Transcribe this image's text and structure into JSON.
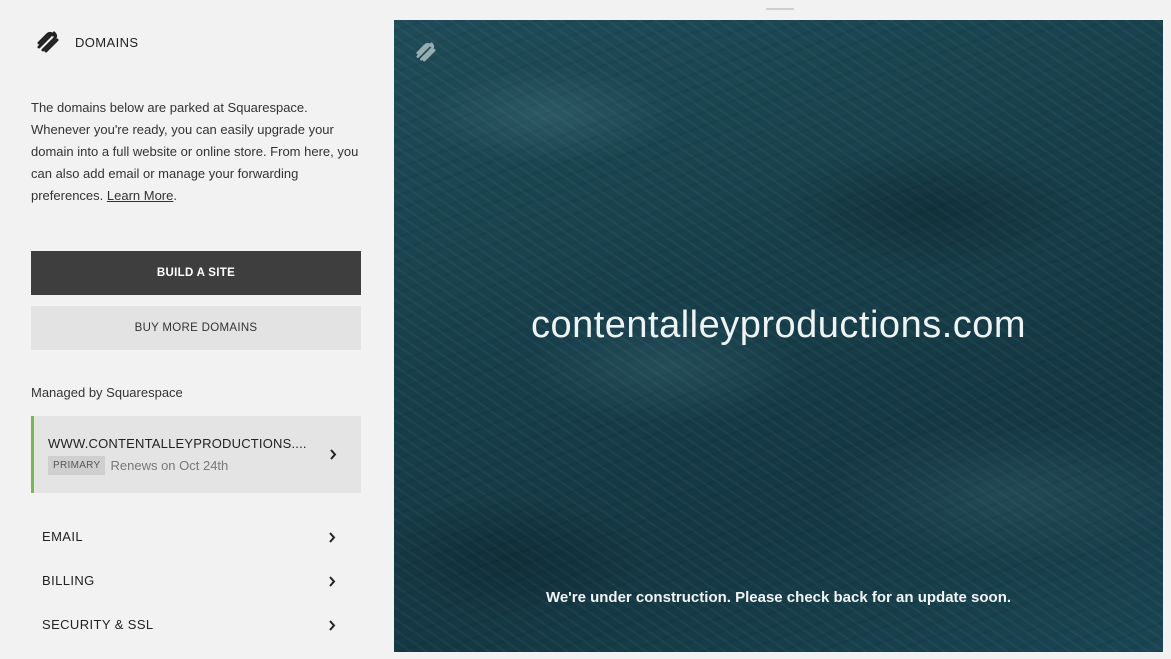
{
  "sidebar": {
    "brand_title": "DOMAINS",
    "intro_text": "The domains below are parked at Squarespace. Whenever you're ready, you can easily upgrade your domain into a full website or online store. From here, you can also add email or manage your forwarding preferences.",
    "learn_more": "Learn More",
    "build_site_label": "BUILD A SITE",
    "buy_domains_label": "BUY MORE DOMAINS",
    "managed_label": "Managed by Squarespace",
    "domain": {
      "name": "WWW.CONTENTALLEYPRODUCTIONS....",
      "badge": "PRIMARY",
      "renewal": "Renews on Oct 24th"
    },
    "nav": {
      "email": "EMAIL",
      "billing": "BILLING",
      "security": "SECURITY & SSL"
    }
  },
  "preview": {
    "domain": "contentalleyproductions.com",
    "message": "We're under construction. Please check back for an update soon."
  },
  "colors": {
    "primary_button": "#3e3e3e",
    "accent_border": "#76b852",
    "preview_bg": "#173f4b"
  },
  "icons": [
    "squarespace-logo-icon",
    "chevron-right-icon"
  ]
}
